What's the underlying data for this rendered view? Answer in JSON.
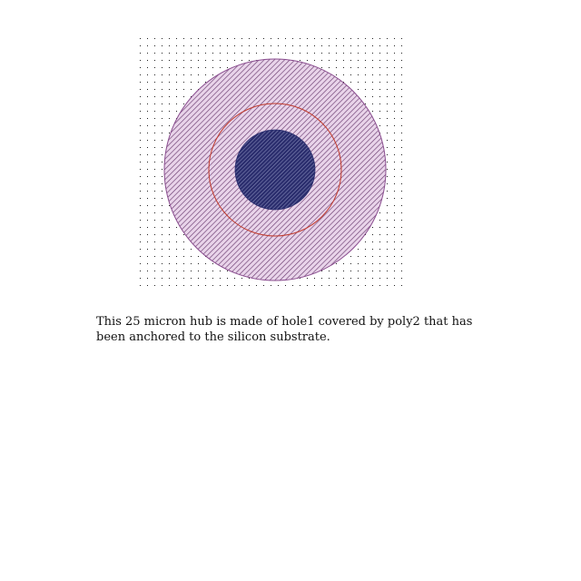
{
  "caption": {
    "text": "This 25 micron hub is made of hole1 covered by poly2 that has been anchored to the silicon substrate."
  },
  "colors": {
    "grid_dot": "#222222",
    "poly2_fill": "#e9d4ea",
    "poly2_hatch": "#6a3c70",
    "poly2_outline": "#8a4d8f",
    "anchor_ring": "#c0392b",
    "hole1_fill": "#2b2e6e",
    "hole1_hatch": "#b9bde3",
    "background": "#ffffff"
  }
}
